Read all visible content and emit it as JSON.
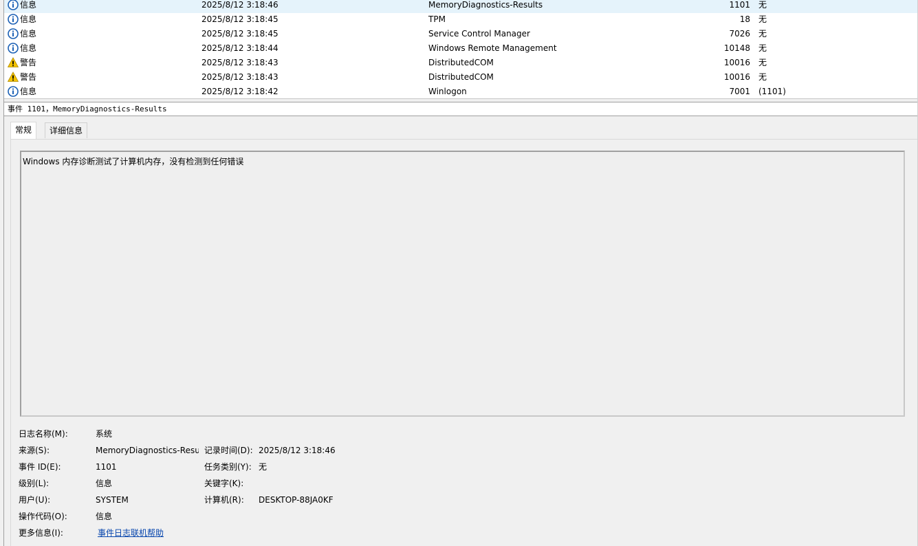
{
  "events": [
    {
      "level": "信息",
      "type": "info",
      "time": "2025/8/12 3:18:46",
      "source": "MemoryDiagnostics-Results",
      "event_id": "1101",
      "category": "无",
      "selected": true
    },
    {
      "level": "信息",
      "type": "info",
      "time": "2025/8/12 3:18:45",
      "source": "TPM",
      "event_id": "18",
      "category": "无"
    },
    {
      "level": "信息",
      "type": "info",
      "time": "2025/8/12 3:18:45",
      "source": "Service Control Manager",
      "event_id": "7026",
      "category": "无"
    },
    {
      "level": "信息",
      "type": "info",
      "time": "2025/8/12 3:18:44",
      "source": "Windows Remote Management",
      "event_id": "10148",
      "category": "无"
    },
    {
      "level": "警告",
      "type": "warning",
      "time": "2025/8/12 3:18:43",
      "source": "DistributedCOM",
      "event_id": "10016",
      "category": "无"
    },
    {
      "level": "警告",
      "type": "warning",
      "time": "2025/8/12 3:18:43",
      "source": "DistributedCOM",
      "event_id": "10016",
      "category": "无"
    },
    {
      "level": "信息",
      "type": "info",
      "time": "2025/8/12 3:18:42",
      "source": "Winlogon",
      "event_id": "7001",
      "category": "(1101)"
    }
  ],
  "detail": {
    "header": "事件 1101，MemoryDiagnostics-Results",
    "tabs": [
      "常规",
      "详细信息"
    ],
    "description": "Windows 内存诊断测试了计算机内存，没有检测到任何错误",
    "props": {
      "log_name_label": "日志名称(M):",
      "log_name_value": "系统",
      "source_label": "来源(S):",
      "source_value": "MemoryDiagnostics-Resu",
      "logged_label": "记录时间(D):",
      "logged_value": "2025/8/12 3:18:46",
      "event_id_label": "事件 ID(E):",
      "event_id_value": "1101",
      "task_label": "任务类别(Y):",
      "task_value": "无",
      "level_label": "级别(L):",
      "level_value": "信息",
      "keywords_label": "关键字(K):",
      "user_label": "用户(U):",
      "user_value": "SYSTEM",
      "computer_label": "计算机(R):",
      "computer_value": "DESKTOP-88JA0KF",
      "opcode_label": "操作代码(O):",
      "opcode_value": "信息",
      "more_info_label": "更多信息(I):",
      "more_info_link": "事件日志联机帮助"
    }
  },
  "icons": {
    "info": "info-circle-icon",
    "warning": "warning-triangle-icon"
  },
  "colors": {
    "info_icon": "#1a5fb4",
    "warning_icon": "#f5c400",
    "link": "#0645ad",
    "selected_row": "#e5f3fb"
  }
}
